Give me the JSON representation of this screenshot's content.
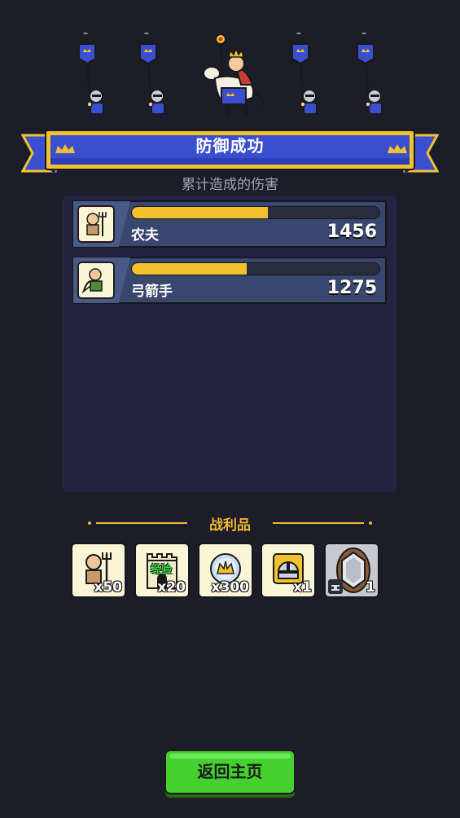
{
  "header": {
    "title": "防御成功",
    "subtitle": "累计造成的伤害"
  },
  "damage": [
    {
      "unit": "农夫",
      "value": "1456",
      "fraction": 0.55,
      "icon": "farmer-icon"
    },
    {
      "unit": "弓箭手",
      "value": "1275",
      "fraction": 0.465,
      "icon": "archer-icon"
    }
  ],
  "loot": {
    "title": "战利品",
    "items": [
      {
        "name": "farmer-unit",
        "qty": "x50",
        "icon": "farmer-icon"
      },
      {
        "name": "experience-tower",
        "qty": "x20",
        "tag": "经验",
        "icon": "tower-exp-icon"
      },
      {
        "name": "crown-coin",
        "qty": "x300",
        "icon": "crown-coin-icon"
      },
      {
        "name": "helmet-card",
        "qty": "x1",
        "icon": "helmet-icon"
      },
      {
        "name": "gem-card",
        "qty": "1",
        "icon": "gem-icon"
      }
    ]
  },
  "button": {
    "label": "返回主页"
  },
  "colors": {
    "background": "#1b1d29",
    "panel": "#25233f",
    "banner_blue": "#3a4fd0",
    "banner_gold": "#f2c12e",
    "bar_fill": "#f2c12e",
    "loot_gold": "#efb72b",
    "button_green": "#45d02f"
  }
}
